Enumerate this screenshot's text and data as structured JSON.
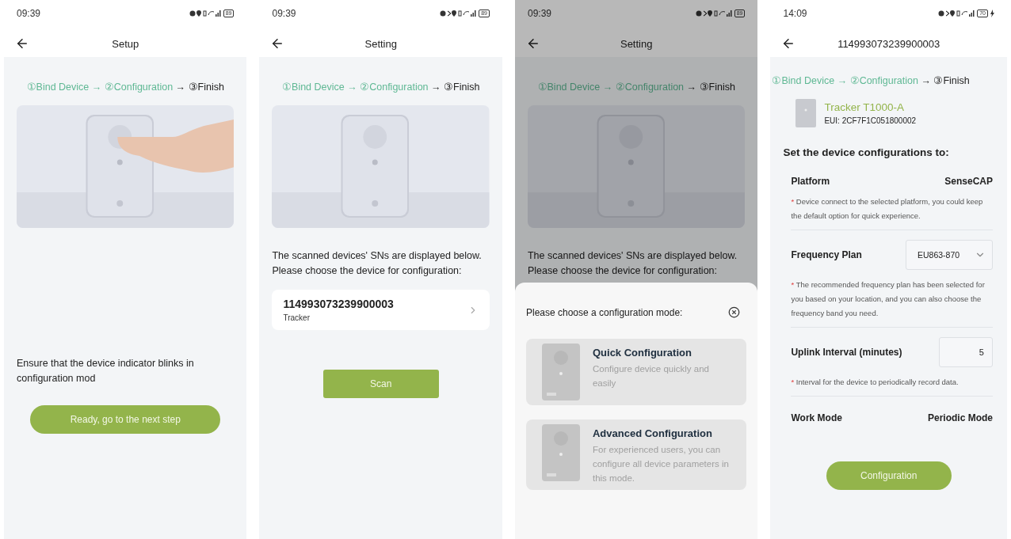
{
  "screens": [
    {
      "kind": "bind",
      "status": {
        "time": "09:39",
        "battery": "89",
        "bluetooth": false,
        "charging": false
      },
      "title": "Setup",
      "step_separator": "→",
      "steps": [
        {
          "label": "①Bind Device",
          "done": true
        },
        {
          "label": "②Configuration",
          "done": true
        },
        {
          "label": "③Finish",
          "done": false
        }
      ],
      "instruction": "Ensure that the device indicator blinks in configuration mod",
      "button": "Ready, go to the next step"
    },
    {
      "kind": "scan",
      "status": {
        "time": "09:39",
        "battery": "89",
        "bluetooth": true,
        "charging": false
      },
      "title": "Setting",
      "step_separator": "→",
      "steps": [
        {
          "label": "①Bind Device",
          "done": true
        },
        {
          "label": "②Configuration",
          "done": true
        },
        {
          "label": "③Finish",
          "done": false
        }
      ],
      "instruction_lines": [
        "The scanned devices' SNs are displayed below.",
        "Please choose the device for configuration:"
      ],
      "devices": [
        {
          "sn": "114993073239900003",
          "type": "Tracker"
        }
      ],
      "button": "Scan"
    },
    {
      "kind": "mode_sheet",
      "status": {
        "time": "09:39",
        "battery": "89",
        "bluetooth": true,
        "charging": false
      },
      "title": "Setting",
      "step_separator": "→",
      "steps": [
        {
          "label": "①Bind Device",
          "done": true
        },
        {
          "label": "②Configuration",
          "done": true
        },
        {
          "label": "③Finish",
          "done": false
        }
      ],
      "instruction_lines": [
        "The scanned devices' SNs are displayed below.",
        "Please choose the device for configuration:"
      ],
      "sheet_title": "Please choose a configuration mode:",
      "options": [
        {
          "title": "Quick Configuration",
          "description": "Configure device quickly and easily"
        },
        {
          "title": "Advanced Configuration",
          "description": "For experienced users, you can configure all device parameters in this mode."
        }
      ]
    },
    {
      "kind": "config",
      "status": {
        "time": "14:09",
        "battery": "70",
        "bluetooth": true,
        "charging": true
      },
      "title": "114993073239900003",
      "step_separator": "→",
      "steps": [
        {
          "label": "①Bind Device",
          "done": true
        },
        {
          "label": "②Configuration",
          "done": true
        },
        {
          "label": "③Finish",
          "done": false
        }
      ],
      "device": {
        "name": "Tracker T1000-A",
        "eui": "EUI: 2CF7F1C051800002"
      },
      "heading": "Set the device configurations to:",
      "note_mark": "*",
      "fields": [
        {
          "kind": "value",
          "label": "Platform",
          "value": "SenseCAP",
          "note": "Device connect to the selected platform, you could keep the default option for quick experience."
        },
        {
          "kind": "select",
          "label": "Frequency Plan",
          "value": "EU863-870",
          "note": "The recommended frequency plan has been selected for you based on your location, and you can also choose the frequency band you need."
        },
        {
          "kind": "input",
          "label": "Uplink Interval (minutes)",
          "value": "5",
          "note": "Interval for the device to periodically record data."
        },
        {
          "kind": "value",
          "label": "Work Mode",
          "value": "Periodic Mode"
        }
      ],
      "button": "Configuration"
    }
  ]
}
